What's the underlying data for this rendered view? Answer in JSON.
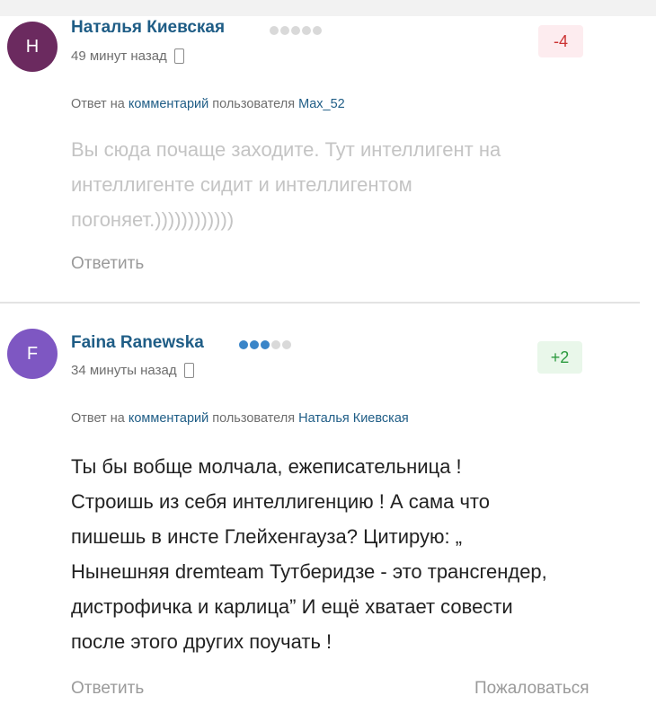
{
  "comments": [
    {
      "avatar_letter": "H",
      "avatar_color": "#6b2a5f",
      "author": "Наталья Киевская",
      "rank_dots_filled": 0,
      "rank_dots_total": 5,
      "time": "49 минут назад",
      "rating": "-4",
      "reply_prefix": "Ответ на",
      "reply_link": "комментарий",
      "reply_mid": "пользователя",
      "reply_user": "Max_52",
      "text_lines": [
        "Вы сюда почаще заходите. Тут интеллигент на",
        "интеллигенте сидит и интеллигентом",
        "погоняет.))))))))))))"
      ],
      "reply_label": "Ответить"
    },
    {
      "avatar_letter": "F",
      "avatar_color": "#7e57c2",
      "author": "Faina Ranewska",
      "rank_dots_filled": 3,
      "rank_dots_total": 5,
      "time": "34 минуты назад",
      "rating": "+2",
      "reply_prefix": "Ответ на",
      "reply_link": "комментарий",
      "reply_mid": "пользователя",
      "reply_user": "Наталья Киевская",
      "text_lines": [
        "Ты бы вобще молчала, ежеписательница !",
        "Строишь из себя интеллигенцию ! А сама что",
        "пишешь в инсте Глейхенгауза? Цитирую: „",
        "Нынешняя dremteam Тутберидзе - это трансгендер,",
        "дистрофичка и карлица” И ещё хватает совести",
        "после этого других поучать !"
      ],
      "reply_label": "Ответить",
      "report_label": "Пожаловаться"
    }
  ]
}
